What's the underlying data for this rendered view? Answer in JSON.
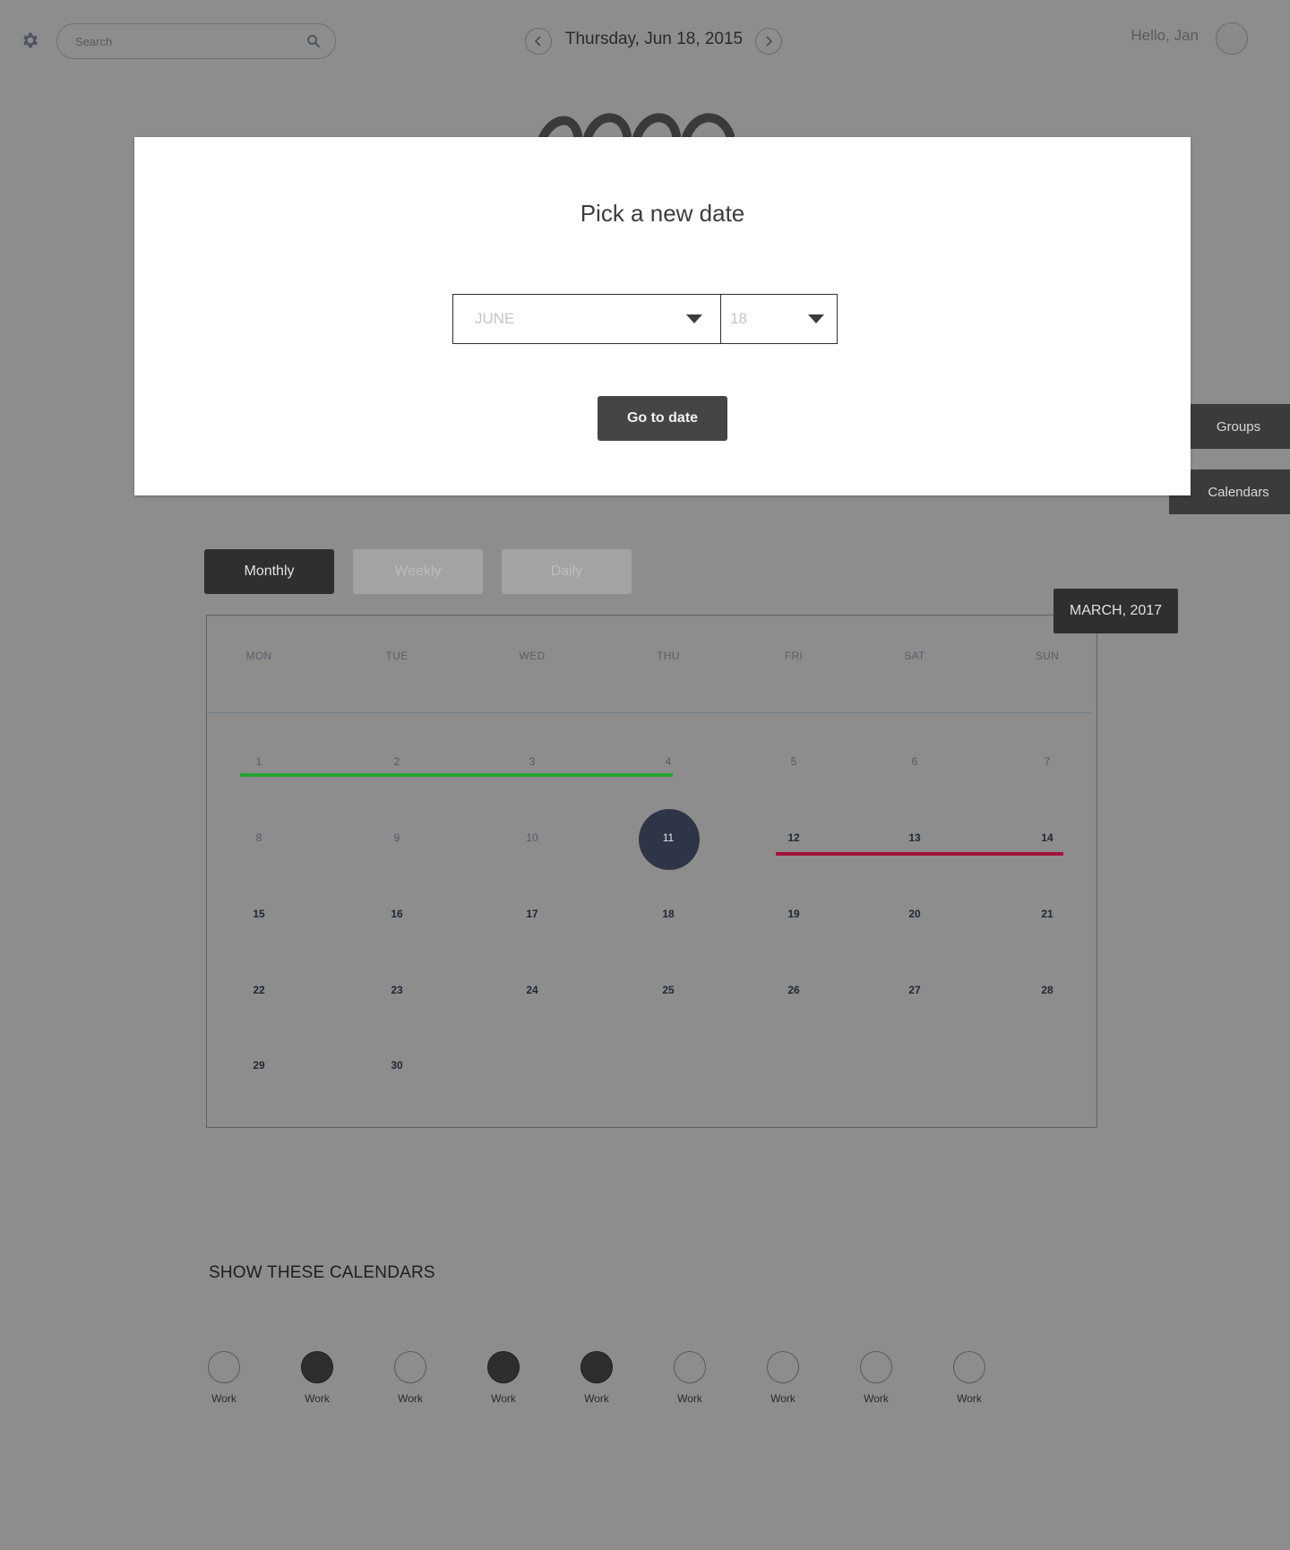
{
  "header": {
    "search_placeholder": "Search",
    "date_title": "Thursday, Jun 18, 2015",
    "greeting": "Hello, Jan"
  },
  "side_tabs": {
    "groups": "Groups",
    "calendars": "Calendars"
  },
  "views": {
    "monthly": "Monthly",
    "weekly": "Weekly",
    "daily": "Daily",
    "active": "Monthly"
  },
  "calendar": {
    "month_label": "MARCH, 2017",
    "day_headers": [
      "MON",
      "TUE",
      "WED",
      "THU",
      "FRI",
      "SAT",
      "SUN"
    ],
    "weeks": [
      [
        "1",
        "2",
        "3",
        "4",
        "5",
        "6",
        "7"
      ],
      [
        "8",
        "9",
        "10",
        "11",
        "12",
        "13",
        "14"
      ],
      [
        "15",
        "16",
        "17",
        "18",
        "19",
        "20",
        "21"
      ],
      [
        "22",
        "23",
        "24",
        "25",
        "26",
        "27",
        "28"
      ],
      [
        "29",
        "30"
      ]
    ],
    "selected_date": "11",
    "events": [
      {
        "from": "1",
        "to": "4",
        "color": "#22a22f"
      },
      {
        "from": "12",
        "to": "14",
        "color": "#a4123a"
      }
    ]
  },
  "legend": {
    "title": "SHOW THESE CALENDARS",
    "items": [
      {
        "label": "Work",
        "checked": false
      },
      {
        "label": "Work",
        "checked": true
      },
      {
        "label": "Work",
        "checked": false
      },
      {
        "label": "Work",
        "checked": true
      },
      {
        "label": "Work",
        "checked": true
      },
      {
        "label": "Work",
        "checked": false
      },
      {
        "label": "Work",
        "checked": false
      },
      {
        "label": "Work",
        "checked": false
      },
      {
        "label": "Work",
        "checked": false
      }
    ]
  },
  "modal": {
    "title": "Pick a new date",
    "month_select": "JUNE",
    "day_select": "18",
    "go_button": "Go to date"
  },
  "icons": [
    "gear-icon",
    "search-icon",
    "chevron-left-icon",
    "chevron-right-icon",
    "caret-down-icon"
  ],
  "colors": {
    "overlay_bg": "#8d8d8d",
    "event_green": "#22a22f",
    "event_red": "#a4123a",
    "selected_day": "#2d3547",
    "button_dark": "#454545"
  }
}
